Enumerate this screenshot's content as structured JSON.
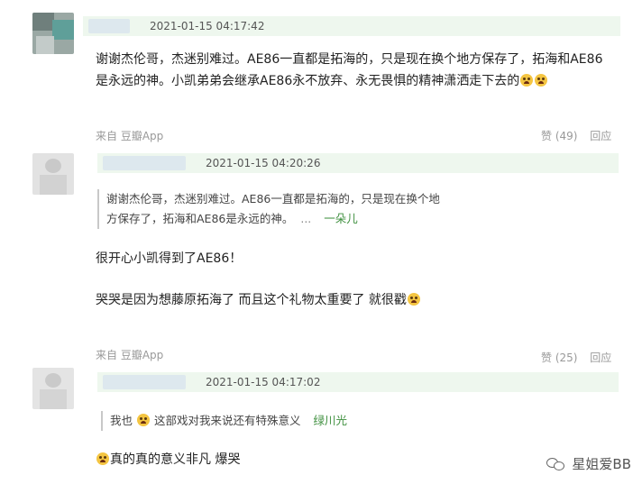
{
  "comments": [
    {
      "time": "2021-01-15 04:17:42",
      "text_line1": "谢谢杰伦哥，杰迷别难过。AE86一直都是拓海的，只是现在换个地方保存了，拓海和AE86",
      "text_line2": "是永远的神。小凯弟弟会继承AE86永不放弃、永无畏惧的精神潇洒走下去的",
      "source": "来自 豆瓣App",
      "likes": "赞 (49)",
      "reply": "回应"
    },
    {
      "time": "2021-01-15 04:20:26",
      "quote_line1": "谢谢杰伦哥，杰迷别难过。AE86一直都是拓海的，只是现在换个地",
      "quote_line2": "方保存了，拓海和AE86是永远的神。",
      "quote_more": "...",
      "quote_author": "一朵儿",
      "text_line1": "很开心小凯得到了AE86！",
      "text_line2": "哭哭是因为想藤原拓海了 而且这个礼物太重要了 就很戳",
      "source": "来自 豆瓣App",
      "likes": "赞 (25)",
      "reply": "回应"
    },
    {
      "time": "2021-01-15 04:17:02",
      "quote_line1_a": "我也",
      "quote_line1_b": "这部戏对我来说还有特殊意义",
      "quote_author": "绿川光",
      "text_line1": "真的真的意义非凡 爆哭"
    }
  ],
  "watermark": {
    "text": "星姐爱BB",
    "icon": "wechat-icon"
  },
  "emoji_icon": "crying-face-icon",
  "colors": {
    "header_bg": "#eef7ee",
    "quote_author": "#3e8f3e",
    "meta": "#999999"
  }
}
